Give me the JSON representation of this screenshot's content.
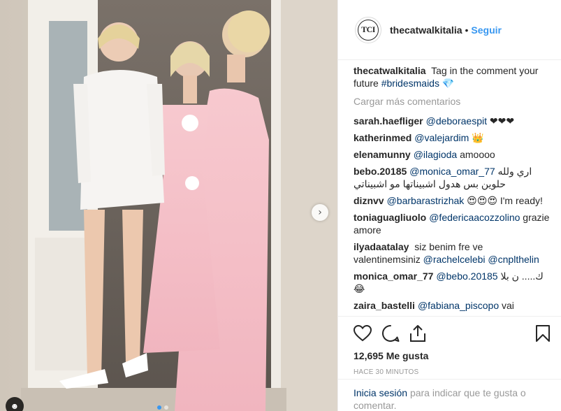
{
  "header": {
    "avatar_text": "TCI",
    "username": "thecatwalkitalia",
    "separator": "•",
    "follow_label": "Seguir"
  },
  "caption": {
    "user": "thecatwalkitalia",
    "text": "Tag in the comment your future",
    "hashtag": "#bridesmaids",
    "trail": "💎"
  },
  "load_more": "Cargar más comentarios",
  "comments": [
    {
      "user": "sarah.haefliger",
      "tag": "@deboraespit",
      "text": "❤❤❤"
    },
    {
      "user": "katherinmed",
      "tag": "@valejardim",
      "text": "👑"
    },
    {
      "user": "elenamunny",
      "tag": "@ilagioda",
      "text": "amoooo"
    },
    {
      "user": "bebo.20185",
      "tag": "@monica_omar_77",
      "text": "اري ولله حلوين بس هدول اشبيناتها مو اشبيناتي"
    },
    {
      "user": "diznvv",
      "tag": "@barbarastrizhak",
      "text": "😍😍😍 I'm ready!"
    },
    {
      "user": "toniaguagliuolo",
      "tag": "@federicaacozzolino",
      "text": "grazie amore"
    },
    {
      "user": "ilyadaatalay",
      "pre": "siz benim fre ve valentinemsiniz",
      "tag": "@rachelcelebi",
      "tag2": "@cnplthelin",
      "text": ""
    },
    {
      "user": "monica_omar_77",
      "tag": "@bebo.20185",
      "text": "ك..... ن بلا 😂"
    },
    {
      "user": "zaira_bastelli",
      "tag": "@fabiana_piscopo",
      "text": "vai"
    }
  ],
  "actions": {
    "likes": "12,695 Me gusta",
    "time": "HACE 30 MINUTOS"
  },
  "login": {
    "link": "Inicia sesión",
    "text": "para indicar que te gusta o comentar."
  },
  "icons": [
    "heart-icon",
    "comment-icon",
    "share-icon",
    "bookmark-icon",
    "chevron-right-icon",
    "user-tag-icon"
  ],
  "colors": {
    "link": "#003569",
    "follow": "#3897f0",
    "muted": "#999999",
    "dress_pink": "#f4c4cc"
  }
}
